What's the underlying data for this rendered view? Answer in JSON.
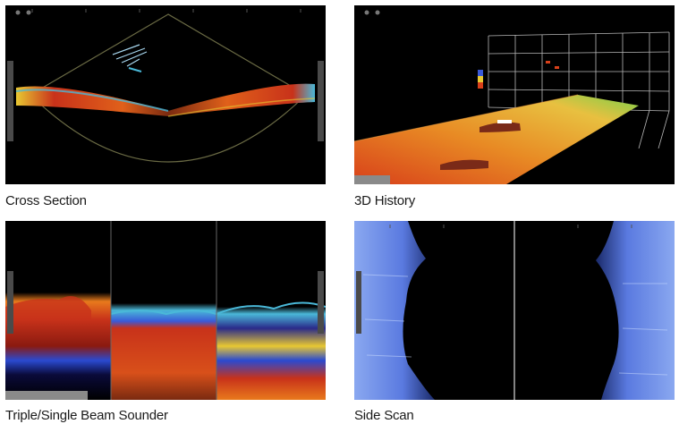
{
  "panels": [
    {
      "id": "cross-section",
      "caption": "Cross Section"
    },
    {
      "id": "3d-history",
      "caption": "3D History"
    },
    {
      "id": "triple-single-beam-sounder",
      "caption": "Triple/Single Beam Sounder"
    },
    {
      "id": "side-scan",
      "caption": "Side Scan"
    }
  ],
  "colors": {
    "panel_bg": "#000000",
    "echo_red": "#c8321a",
    "echo_orange": "#e87a1c",
    "echo_yellow": "#e8c832",
    "echo_cyan": "#4ab8d8",
    "echo_blue": "#3a5ad8",
    "scan_blue": "#6a8ee8",
    "grid": "#b8b8b8",
    "caption_text": "#1a1a1a"
  },
  "icons": [
    "sonar-fan-icon",
    "3d-grid-icon",
    "echo-column-icon",
    "side-scan-icon"
  ]
}
